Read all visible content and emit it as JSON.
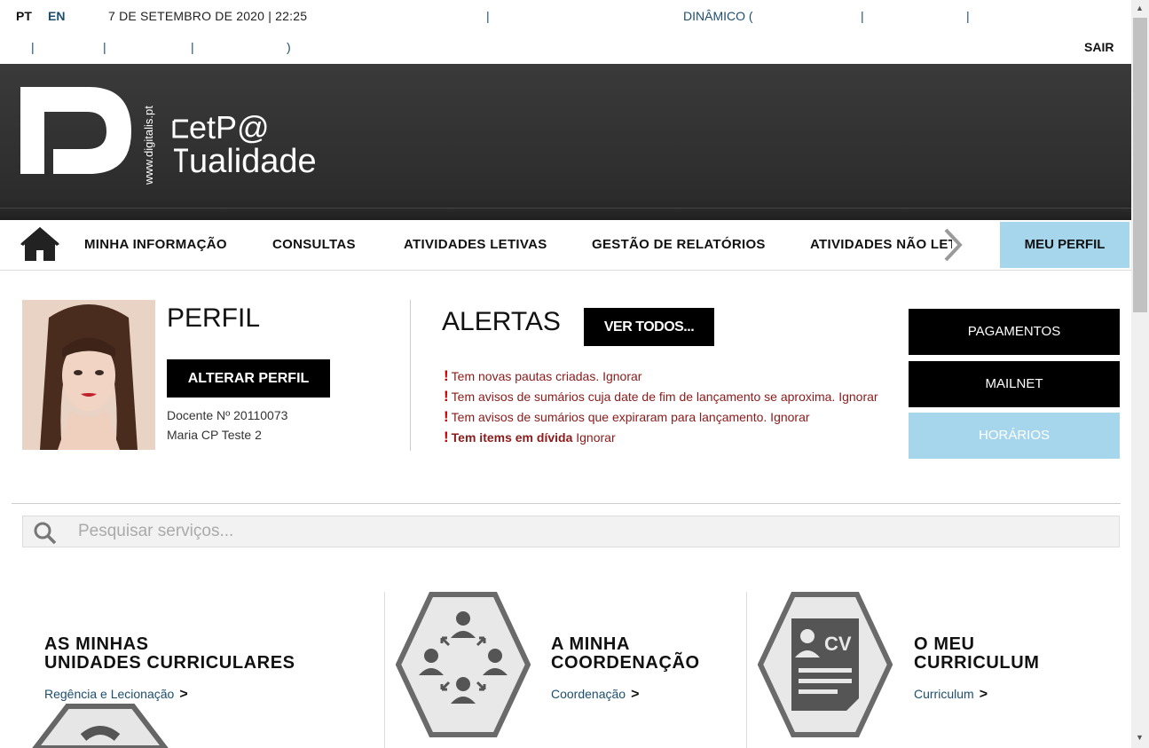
{
  "topbar": {
    "lang_pt": "PT",
    "lang_en": "EN",
    "datetime": "7 DE SETEMBRO DE 2020 | 22:25",
    "sep": "|",
    "dynamic": "DINÂMICO (",
    "close_paren": ")",
    "logout": "SAIR"
  },
  "brand": {
    "site": "www.digitalis.pt",
    "line1": "etP@",
    "line2": "ualidade"
  },
  "nav": {
    "items": [
      "MINHA INFORMAÇÃO",
      "CONSULTAS",
      "ATIVIDADES LETIVAS",
      "GESTÃO DE RELATÓRIOS",
      "ATIVIDADES NÃO LETIVAS"
    ],
    "profile": "MEU PERFIL"
  },
  "profile": {
    "title": "PERFIL",
    "edit_button": "ALTERAR PERFIL",
    "docente": "Docente Nº 20110073",
    "name": "Maria CP Teste 2"
  },
  "alerts": {
    "title": "ALERTAS",
    "view_all": "VER TODOS...",
    "items": [
      {
        "bold": "",
        "text": "Tem novas pautas criadas. Ignorar"
      },
      {
        "bold": "",
        "text": "Tem avisos de sumários cuja date de fim de lançamento se aproxima. Ignorar"
      },
      {
        "bold": "",
        "text": "Tem avisos de sumários que expiraram para lançamento. Ignorar"
      },
      {
        "bold": "Tem items em dívida",
        "text": " Ignorar"
      }
    ]
  },
  "side_buttons": {
    "payments": "PAGAMENTOS",
    "mailnet": "MAILNET",
    "schedules": "HORÁRIOS"
  },
  "search": {
    "placeholder": "Pesquisar serviços..."
  },
  "cards": [
    {
      "title_line1": "AS MINHAS",
      "title_line2": "UNIDADES CURRICULARES",
      "link": "Regência e Lecionação"
    },
    {
      "title_line1": "A MINHA",
      "title_line2": "COORDENAÇÃO",
      "link": "Coordenação"
    },
    {
      "title_line1": "O MEU",
      "title_line2": "CURRICULUM",
      "link": "Curriculum"
    }
  ],
  "cv_badge": "CV",
  "colors": {
    "accent_light_blue": "#a6d6ec",
    "alert_red": "#8b1a1a",
    "link_blue": "#1d4e6e"
  }
}
